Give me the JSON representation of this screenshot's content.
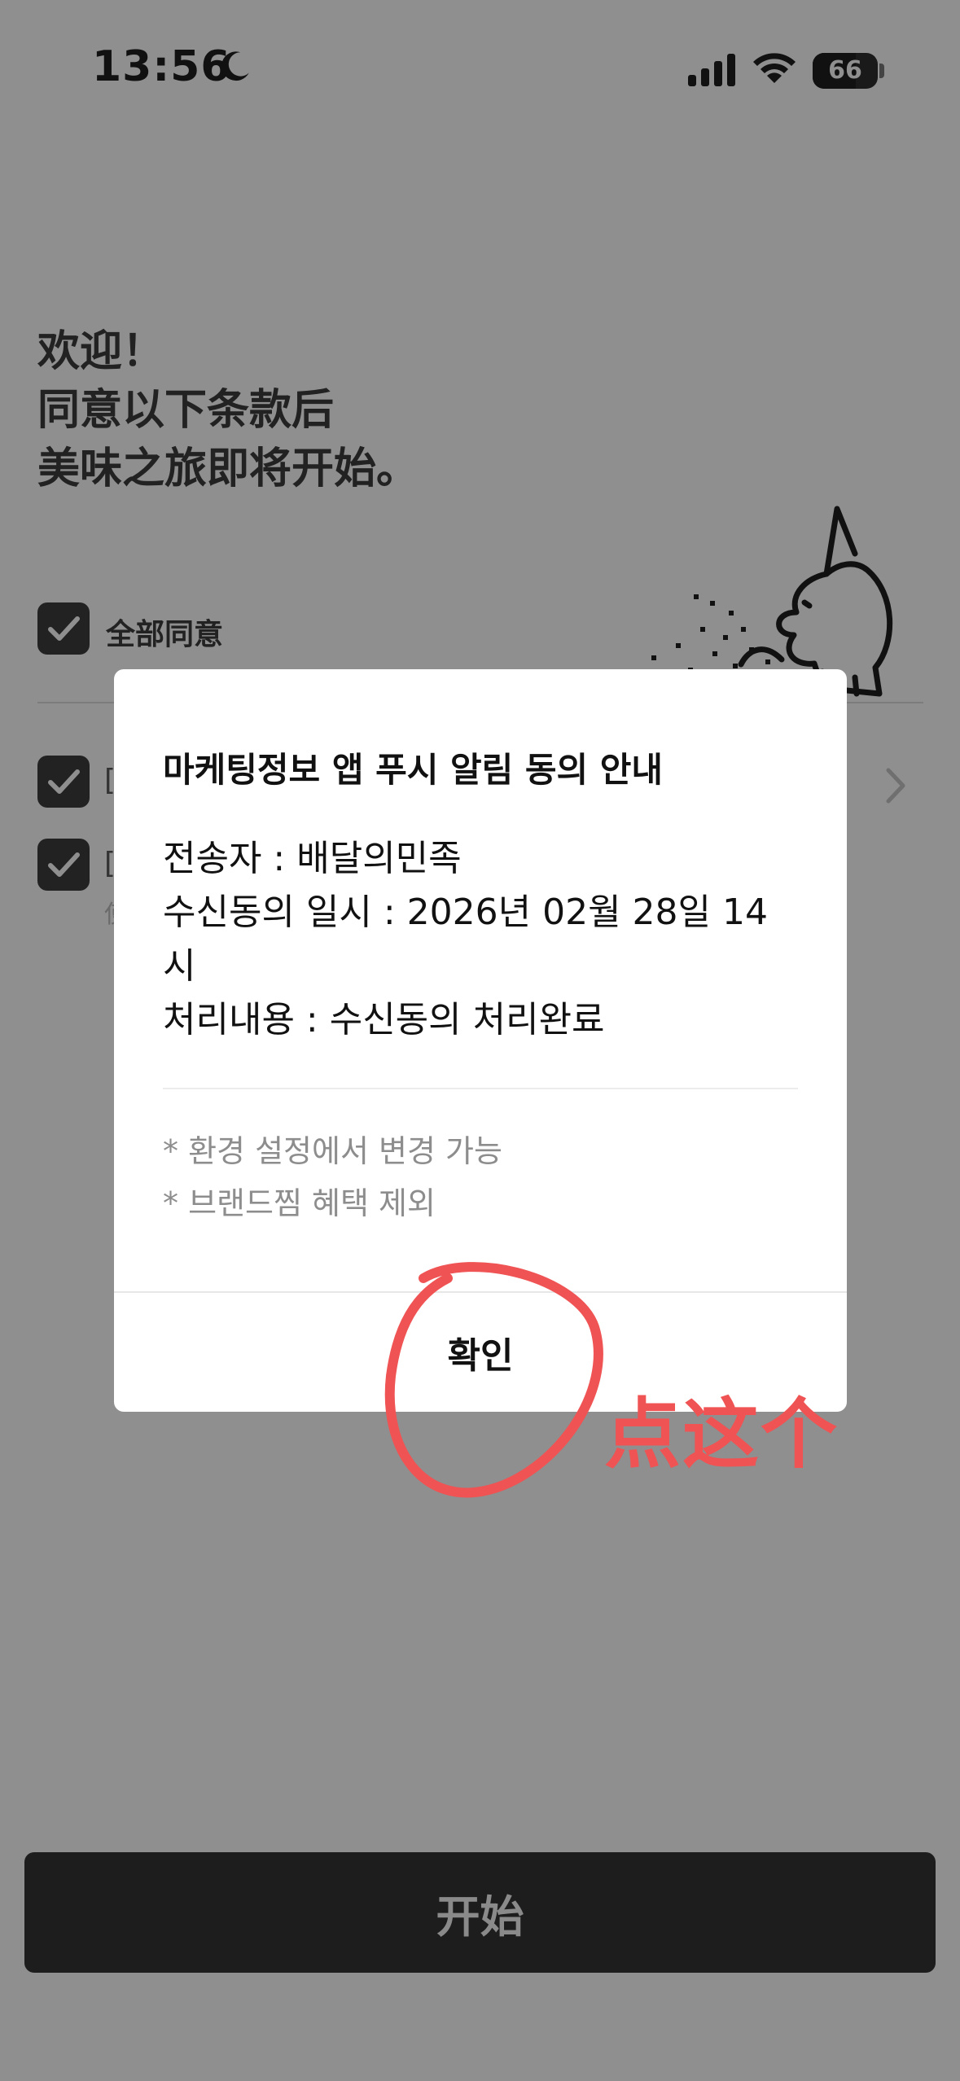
{
  "status_bar": {
    "time": "13:56",
    "battery": "66"
  },
  "welcome": {
    "line1": "欢迎！",
    "line2": "同意以下条款后",
    "line3": "美味之旅即将开始。"
  },
  "agree_all": {
    "label": "全部同意",
    "checked": true
  },
  "background_items": [
    {
      "label": "[",
      "checked": true
    },
    {
      "label": "[",
      "sub": "使",
      "checked": true
    }
  ],
  "dialog": {
    "title": "마케팅정보 앱 푸시 알림 동의 안내",
    "sender": "전송자 : 배달의민족",
    "datetime_line1": "수신동의 일시 : 2026년 02월 28일 14",
    "datetime_line2": "시",
    "result": "처리내용 : 수신동의 처리완료",
    "note1": "* 환경 설정에서 변경 가능",
    "note2": "* 브랜드찜 혜택 제외",
    "confirm_label": "확인"
  },
  "start_button": {
    "label": "开始"
  },
  "annotation": {
    "text": "点这个",
    "color": "#f05353"
  },
  "colors": {
    "overlay_bg": "#8f8f8f",
    "dialog_bg": "#ffffff",
    "dark_button": "#1d1d1d",
    "annotation": "#f05353"
  }
}
